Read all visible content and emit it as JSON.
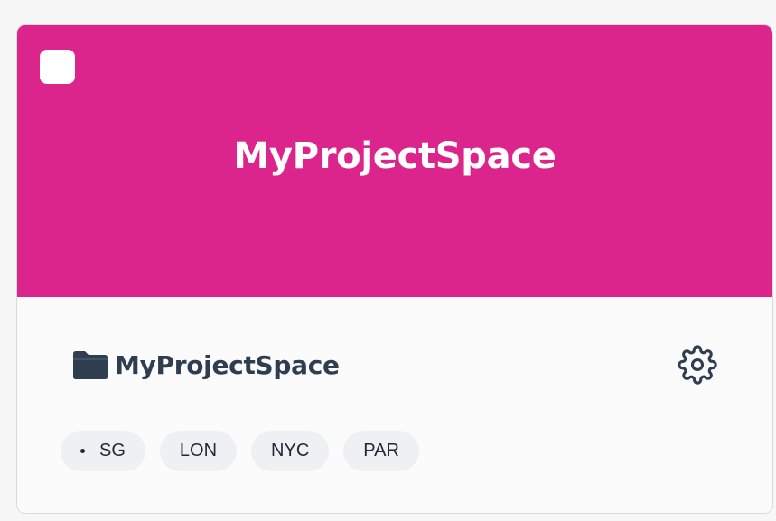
{
  "card": {
    "banner_title": "MyProjectSpace",
    "banner_color": "#dc258c",
    "project_name": "MyProjectSpace",
    "icons": {
      "folder": "folder-icon",
      "settings": "gear-icon"
    },
    "tags": [
      {
        "label": "SG",
        "active": true
      },
      {
        "label": "LON",
        "active": false
      },
      {
        "label": "NYC",
        "active": false
      },
      {
        "label": "PAR",
        "active": false
      }
    ]
  }
}
